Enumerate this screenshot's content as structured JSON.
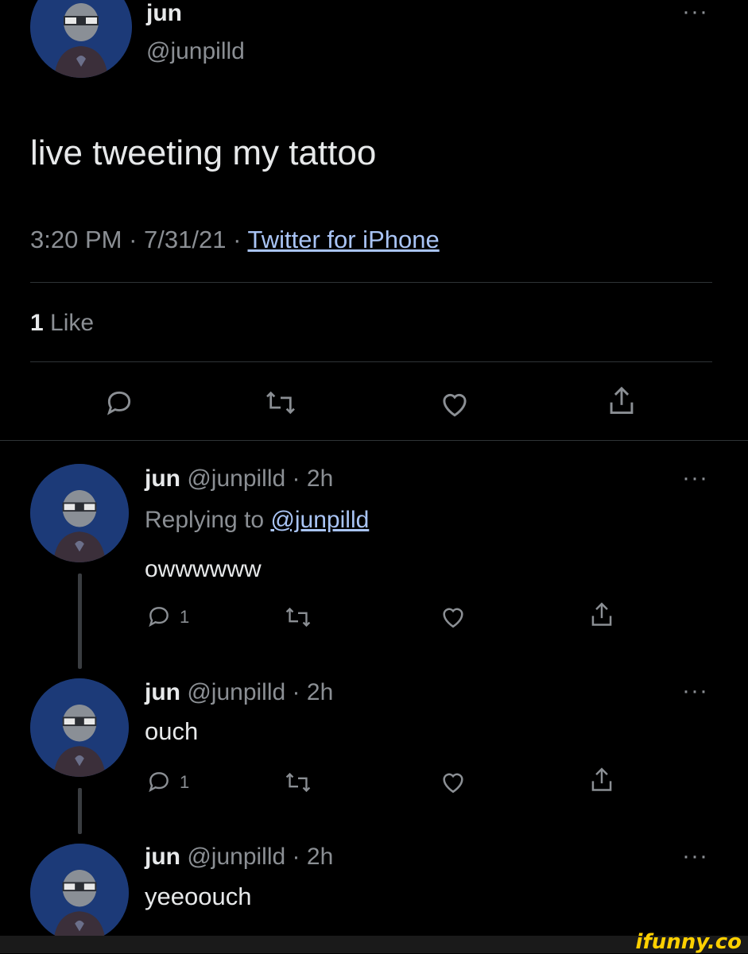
{
  "main_tweet": {
    "display_name": "jun",
    "handle": "@junpilld",
    "text": "live tweeting my tattoo",
    "time": "3:20 PM",
    "date": "7/31/21",
    "source": "Twitter for iPhone",
    "likes_count": "1",
    "likes_label": "Like"
  },
  "replies": [
    {
      "display_name": "jun",
      "handle": "@junpilld",
      "age": "2h",
      "replying_prefix": "Replying to",
      "replying_to": "@junpilld",
      "text": "owwwwww",
      "reply_count": "1"
    },
    {
      "display_name": "jun",
      "handle": "@junpilld",
      "age": "2h",
      "text": "ouch",
      "reply_count": "1"
    },
    {
      "display_name": "jun",
      "handle": "@junpilld",
      "age": "2h",
      "text": "yeeoouch"
    }
  ],
  "separator": "·",
  "more_glyph": "···",
  "watermark": "ifunny.co",
  "icons": [
    "reply-icon",
    "retweet-icon",
    "like-icon",
    "share-icon",
    "more-icon"
  ],
  "colors": {
    "background": "#000000",
    "text": "#e7e9ea",
    "muted": "#8b8f94",
    "link": "#a9c4f5",
    "avatar": "#1c3a78",
    "watermark": "#ffd000"
  }
}
